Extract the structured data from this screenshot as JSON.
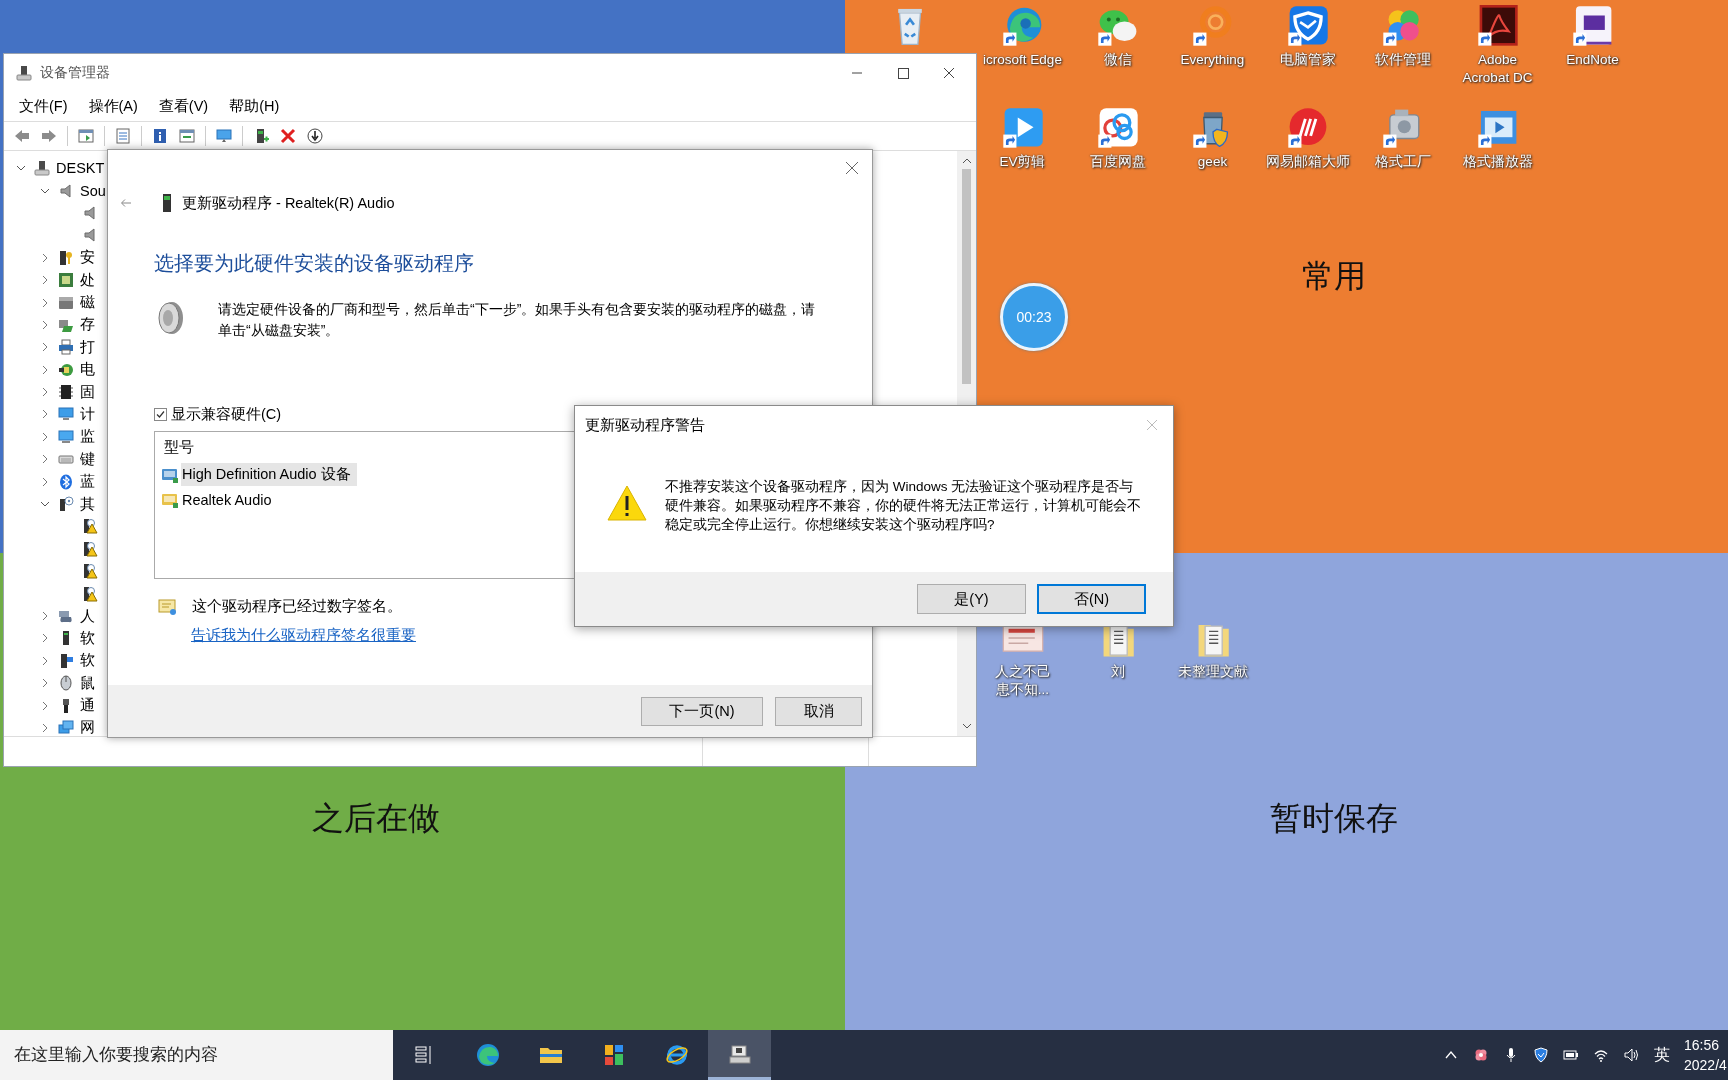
{
  "desktop": {
    "zones": [
      {
        "color": "#4472c4"
      },
      {
        "color": "#ed7d31",
        "label": "常用"
      },
      {
        "color": "#70ad47",
        "label": "之后在做"
      },
      {
        "color": "#8fa5dc",
        "label": "暂时保存"
      }
    ],
    "icon_columns": [
      [
        {
          "kind": "recycle"
        }
      ],
      [
        {
          "kind": "swirl",
          "label": "icrosoft Edge"
        },
        {
          "kind": "play",
          "label": "EV剪辑"
        }
      ],
      [
        {
          "kind": "chat",
          "label": "微信"
        },
        {
          "kind": "cloud",
          "label": "百度网盘"
        }
      ],
      [
        {
          "kind": "ring",
          "label": "Everything"
        },
        {
          "kind": "bin",
          "label": "geek"
        }
      ],
      [
        {
          "kind": "shield",
          "label": "电脑管家"
        },
        {
          "kind": "stripes",
          "label": "网易邮箱大师"
        }
      ],
      [
        {
          "kind": "petals",
          "label": "软件管理"
        },
        {
          "kind": "machine",
          "label": "格式工厂"
        }
      ],
      [
        {
          "kind": "pdf",
          "label": "Adobe Acrobat DC"
        },
        {
          "kind": "film",
          "label": "格式播放器"
        }
      ],
      [
        {
          "kind": "note",
          "label": "EndNote"
        }
      ]
    ],
    "files": [
      {
        "kind": "thumbnail",
        "label": "人之不己患不知..."
      },
      {
        "kind": "folder",
        "label": "刘"
      },
      {
        "kind": "folder",
        "label": "未整理文献"
      }
    ],
    "timer": "00:23"
  },
  "device_manager": {
    "title": "设备管理器",
    "menu": [
      "文件(F)",
      "操作(A)",
      "查看(V)",
      "帮助(H)"
    ],
    "tree": [
      {
        "label": "DESKT",
        "kind": "computer",
        "expanded": true,
        "children": [
          {
            "label": "Sou",
            "kind": "speaker",
            "expanded": true,
            "children": [
              {
                "kind": "speaker"
              },
              {
                "kind": "speaker"
              }
            ]
          },
          {
            "label": "安",
            "kind": "security",
            "expanded": false
          },
          {
            "label": "处",
            "kind": "cpu",
            "expanded": false
          },
          {
            "label": "磁",
            "kind": "disk",
            "expanded": false
          },
          {
            "label": "存",
            "kind": "storage",
            "expanded": false
          },
          {
            "label": "打",
            "kind": "printer",
            "expanded": false
          },
          {
            "label": "电",
            "kind": "battery",
            "expanded": false
          },
          {
            "label": "固",
            "kind": "firmware",
            "expanded": false
          },
          {
            "label": "计",
            "kind": "pc",
            "expanded": false
          },
          {
            "label": "监",
            "kind": "monitor",
            "expanded": false
          },
          {
            "label": "键",
            "kind": "keyboard",
            "expanded": false
          },
          {
            "label": "蓝",
            "kind": "bluetooth",
            "expanded": false
          },
          {
            "label": "其",
            "kind": "unknown",
            "expanded": true,
            "children": [
              {
                "kind": "warning"
              },
              {
                "kind": "warning"
              },
              {
                "kind": "warning"
              },
              {
                "kind": "warning"
              }
            ]
          },
          {
            "label": "人",
            "kind": "hid",
            "expanded": false
          },
          {
            "label": "软",
            "kind": "software",
            "expanded": false
          },
          {
            "label": "软",
            "kind": "component",
            "expanded": false
          },
          {
            "label": "鼠",
            "kind": "mouse",
            "expanded": false
          },
          {
            "label": "通",
            "kind": "usb",
            "expanded": false
          },
          {
            "label": "网",
            "kind": "network",
            "expanded": false
          }
        ]
      }
    ]
  },
  "update_driver": {
    "title": "更新驱动程序 - Realtek(R) Audio",
    "heading": "选择要为此硬件安装的设备驱动程序",
    "instructions": "请选定硬件设备的厂商和型号，然后单击“下一步”。如果手头有包含要安装的驱动程序的磁盘，请单击“从磁盘安装”。",
    "show_compatible": {
      "label": "显示兼容硬件(C)",
      "checked": true
    },
    "model_column": "型号",
    "models": [
      {
        "label": "High Definition Audio 设备",
        "color": "#4a8fcc",
        "selected": true
      },
      {
        "label": "Realtek Audio",
        "color": "#e8c24a",
        "selected": false
      }
    ],
    "signature_note": "这个驱动程序已经过数字签名。",
    "signature_link": "告诉我为什么驱动程序签名很重要",
    "buttons": [
      "下一页(N)",
      "取消"
    ]
  },
  "warning": {
    "title": "更新驱动程序警告",
    "message": "不推荐安装这个设备驱动程序，因为 Windows 无法验证这个驱动程序是否与硬件兼容。如果驱动程序不兼容，你的硬件将无法正常运行，计算机可能会不稳定或完全停止运行。你想继续安装这个驱动程序吗?",
    "buttons": [
      {
        "label": "是(Y)",
        "default": false
      },
      {
        "label": "否(N)",
        "default": true
      }
    ]
  },
  "taskbar": {
    "search": {
      "placeholder": "在这里输入你要搜索的内容"
    },
    "apps": [
      {
        "kind": "task-view",
        "active": false
      },
      {
        "kind": "swirl",
        "active": false
      },
      {
        "kind": "folder",
        "active": false
      },
      {
        "kind": "tiles",
        "active": false
      },
      {
        "kind": "globe",
        "active": false
      },
      {
        "kind": "computer",
        "active": true
      }
    ],
    "tray": {
      "input_method": "英",
      "time": "16:56",
      "date": "2022/4"
    }
  }
}
